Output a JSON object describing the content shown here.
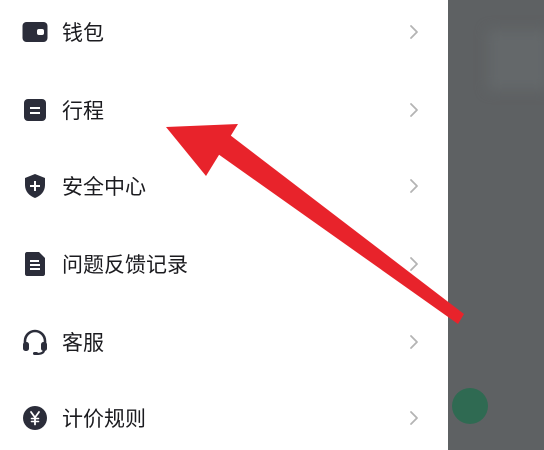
{
  "menu": {
    "items": [
      {
        "label": "钱包",
        "icon": "wallet-icon"
      },
      {
        "label": "行程",
        "icon": "trip-icon"
      },
      {
        "label": "安全中心",
        "icon": "shield-icon"
      },
      {
        "label": "问题反馈记录",
        "icon": "feedback-record-icon"
      },
      {
        "label": "客服",
        "icon": "headset-icon"
      },
      {
        "label": "计价规则",
        "icon": "yuan-icon"
      }
    ]
  },
  "annotation": {
    "type": "arrow",
    "color": "#e8232b",
    "points_to": "行程"
  },
  "colors": {
    "icon": "#2b2d3a",
    "text": "#1b1b1f",
    "chevron": "#b4b4b4",
    "backdrop": "#5e6163"
  }
}
